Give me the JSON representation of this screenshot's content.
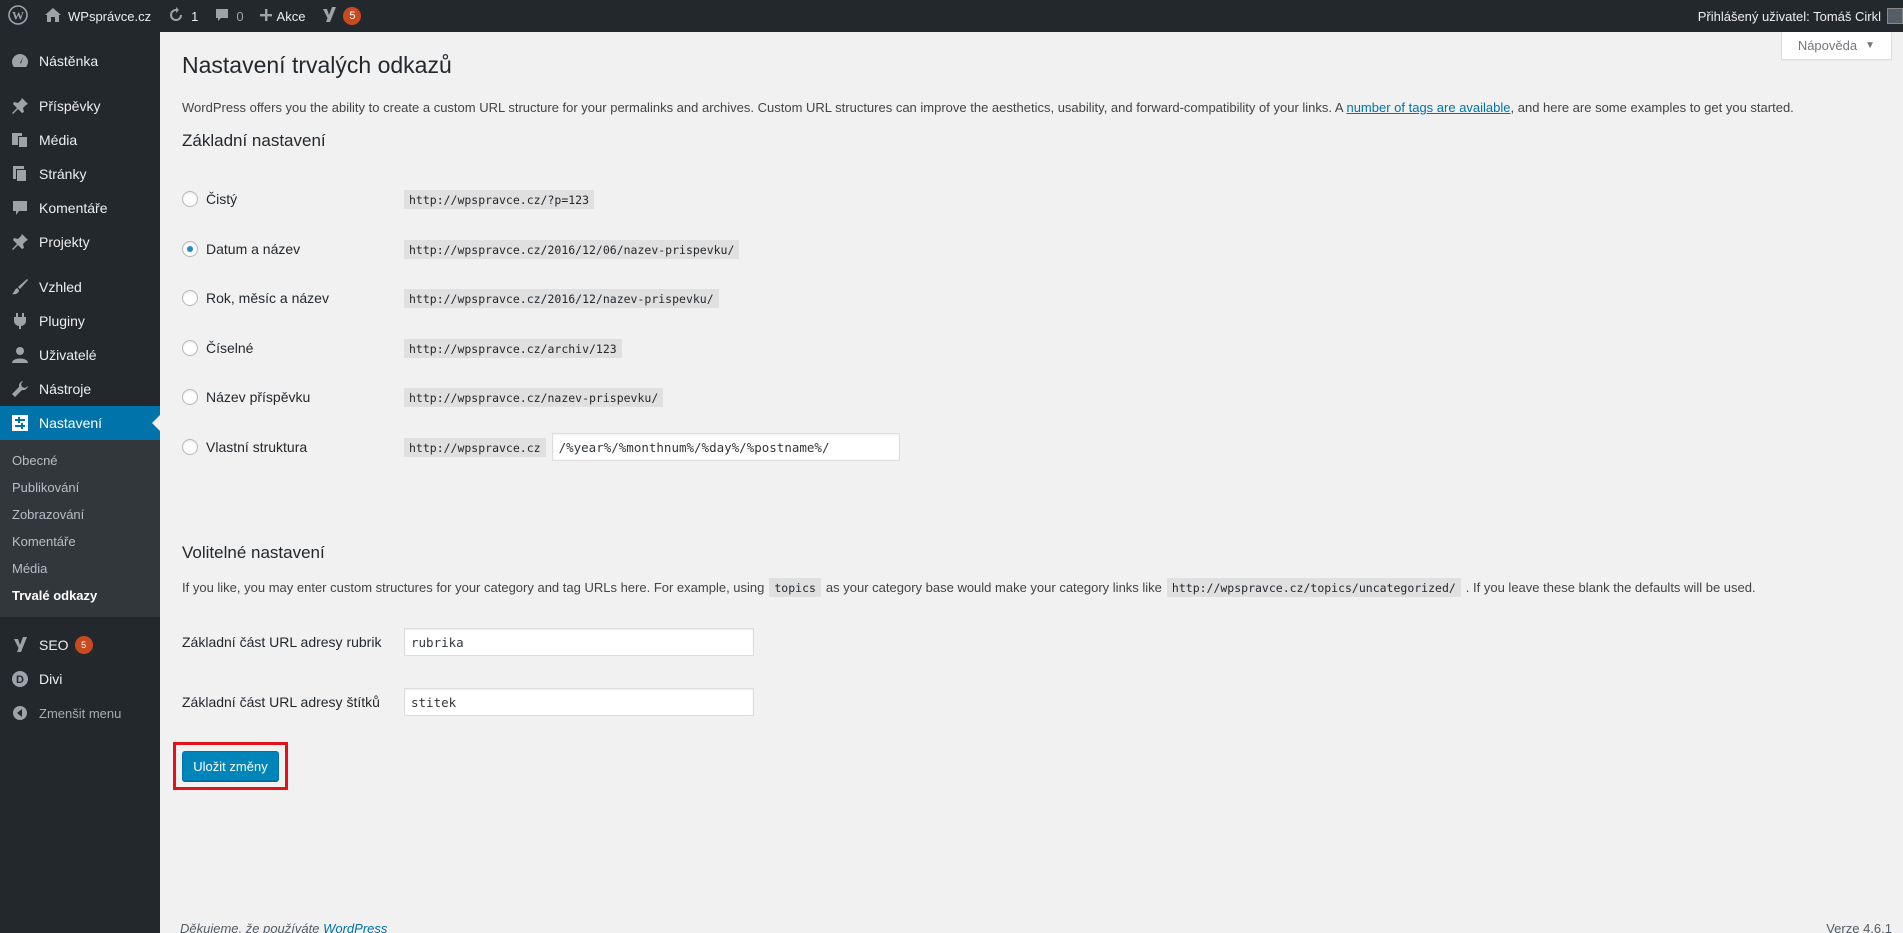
{
  "adminbar": {
    "site_name": "WPsprávce.cz",
    "updates_count": "1",
    "comments_count": "0",
    "new_label": "Akce",
    "seo_badge": "5",
    "user_greeting": "Přihlášený uživatel: Tomáš Cirkl"
  },
  "sidebar": {
    "items": [
      {
        "label": "Nástěnka",
        "icon": "dashboard-icon"
      },
      {
        "label": "Příspěvky",
        "icon": "pin-icon"
      },
      {
        "label": "Média",
        "icon": "media-icon"
      },
      {
        "label": "Stránky",
        "icon": "pages-icon"
      },
      {
        "label": "Komentáře",
        "icon": "comment-icon"
      },
      {
        "label": "Projekty",
        "icon": "pin-icon"
      },
      {
        "label": "Vzhled",
        "icon": "brush-icon"
      },
      {
        "label": "Pluginy",
        "icon": "plugin-icon"
      },
      {
        "label": "Uživatelé",
        "icon": "user-icon"
      },
      {
        "label": "Nástroje",
        "icon": "wrench-icon"
      },
      {
        "label": "Nastavení",
        "icon": "settings-icon"
      }
    ],
    "submenu": [
      "Obecné",
      "Publikování",
      "Zobrazování",
      "Komentáře",
      "Média",
      "Trvalé odkazy"
    ],
    "seo_label": "SEO",
    "seo_badge": "5",
    "divi_label": "Divi",
    "collapse_label": "Zmenšit menu"
  },
  "help_tab": "Nápověda",
  "page_title": "Nastavení trvalých odkazů",
  "intro": {
    "before": "WordPress offers you the ability to create a custom URL structure for your permalinks and archives. Custom URL structures can improve the aesthetics, usability, and forward-compatibility of your links. A ",
    "link": "number of tags are available",
    "after": ", and here are some examples to get you started."
  },
  "common_heading": "Základní nastavení",
  "options": [
    {
      "label": "Čistý",
      "example": "http://wpspravce.cz/?p=123",
      "checked": false
    },
    {
      "label": "Datum a název",
      "example": "http://wpspravce.cz/2016/12/06/nazev-prispevku/",
      "checked": true
    },
    {
      "label": "Rok, měsíc a název",
      "example": "http://wpspravce.cz/2016/12/nazev-prispevku/",
      "checked": false
    },
    {
      "label": "Číselné",
      "example": "http://wpspravce.cz/archiv/123",
      "checked": false
    },
    {
      "label": "Název příspěvku",
      "example": "http://wpspravce.cz/nazev-prispevku/",
      "checked": false
    },
    {
      "label": "Vlastní struktura",
      "example": "http://wpspravce.cz",
      "checked": false
    }
  ],
  "custom_structure_value": "/%year%/%monthnum%/%day%/%postname%/",
  "optional_heading": "Volitelné nastavení",
  "optional_desc": {
    "part1": "If you like, you may enter custom structures for your category and tag URLs here. For example, using",
    "code1": "topics",
    "part2": "as your category base would make your category links like",
    "code2": "http://wpspravce.cz/topics/uncategorized/",
    "part3": ". If you leave these blank the defaults will be used."
  },
  "category_base": {
    "label": "Základní část URL adresy rubrik",
    "value": "rubrika"
  },
  "tag_base": {
    "label": "Základní část URL adresy štítků",
    "value": "stitek"
  },
  "save_button": "Uložit změny",
  "footer": {
    "thanks": "Děkujeme, že používáte",
    "wp_link": "WordPress",
    "version": "Verze 4.6.1"
  }
}
